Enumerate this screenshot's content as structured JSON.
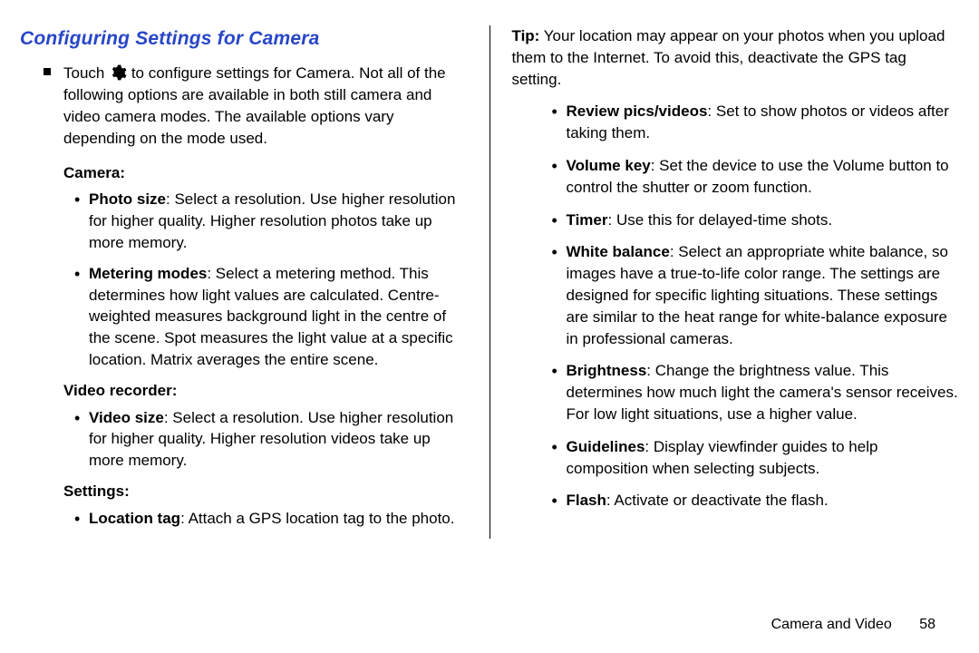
{
  "section_title": "Configuring Settings for Camera",
  "intro": {
    "pre": "Touch ",
    "post": " to configure settings for Camera. Not all of the following options are available in both still camera and video camera modes. The available options vary depending on the mode used."
  },
  "left": {
    "camera_heading": "Camera",
    "camera_items": [
      {
        "term": "Photo size",
        "desc": ": Select a resolution. Use higher resolution for higher quality. Higher resolution photos take up more memory."
      },
      {
        "term": "Metering modes",
        "desc": ": Select a metering method. This determines how light values are calculated. Centre-weighted measures background light in the centre of the scene. Spot measures the light value at a specific location. Matrix averages the entire scene."
      }
    ],
    "video_heading": "Video recorder",
    "video_items": [
      {
        "term": "Video size",
        "desc": ": Select a resolution. Use higher resolution for higher quality. Higher resolution videos take up more memory."
      }
    ],
    "settings_heading": "Settings",
    "settings_items": [
      {
        "term": "Location tag",
        "desc": ": Attach a GPS location tag to the photo."
      }
    ]
  },
  "right": {
    "tip_label": "Tip:",
    "tip_text": " Your location may appear on your photos when you upload them to the Internet. To avoid this, deactivate the GPS tag setting.",
    "items": [
      {
        "term": "Review pics/videos",
        "desc": ": Set to show photos or videos after taking them."
      },
      {
        "term": "Volume key",
        "desc": ": Set the device to use the Volume button to control the shutter or zoom function."
      },
      {
        "term": "Timer",
        "desc": ": Use this for delayed-time shots."
      },
      {
        "term": "White balance",
        "desc": ": Select an appropriate white balance, so images have a true-to-life color range. The settings are designed for specific lighting situations. These settings are similar to the heat range for white-balance exposure in professional cameras."
      },
      {
        "term": "Brightness",
        "desc": ": Change the brightness value. This determines how much light the camera's sensor receives. For low light situations, use a higher value."
      },
      {
        "term": "Guidelines",
        "desc": ": Display viewfinder guides to help composition when selecting subjects."
      },
      {
        "term": "Flash",
        "desc": ": Activate or deactivate the flash."
      }
    ]
  },
  "footer": {
    "section": "Camera and Video",
    "page": "58"
  }
}
